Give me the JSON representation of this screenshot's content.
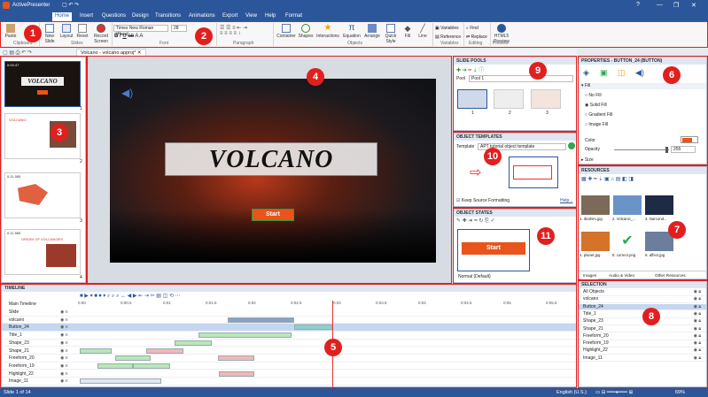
{
  "app": {
    "title": "ActivePresenter"
  },
  "menu": {
    "tabs": [
      "Home",
      "Insert",
      "Questions",
      "Design",
      "Transitions",
      "Animations",
      "Export",
      "View",
      "Help",
      "Format"
    ]
  },
  "ribbon": {
    "groups": [
      "Clipboard",
      "Slides",
      "Font",
      "Paragraph",
      "Objects",
      "Variables",
      "Editing",
      "Preview"
    ],
    "buttons": {
      "paste": "Paste",
      "new_slide": "New Slide",
      "layout": "Layout",
      "reset": "Reset",
      "record": "Record Screen",
      "container": "Container",
      "shapes": "Shapes",
      "interactions": "Interactions",
      "equation": "Equation",
      "arrange": "Arrange",
      "quick_style": "Quick Style",
      "fill": "Fill",
      "line": "Line",
      "variables": "Variables",
      "reference": "Reference",
      "find": "Find",
      "replace": "Replace",
      "html5_preview": "HTML5 Preview"
    },
    "font": {
      "family": "Times New Roman (Head",
      "size": "28"
    }
  },
  "document": {
    "tab": "Volcano - volcano.approj*"
  },
  "slides": {
    "thumbs": [
      {
        "time": "0:03.47",
        "title": "VOLCANO",
        "num": "1"
      },
      {
        "time": "",
        "title": "VOLCANO",
        "num": "2"
      },
      {
        "time": "0:11.565",
        "title": "",
        "num": "3"
      },
      {
        "time": "0:11.565",
        "title": "ORIGIN OF VOLCANOES",
        "num": "4"
      }
    ]
  },
  "canvas": {
    "title": "VOLCANO",
    "button": "Start"
  },
  "slide_pools": {
    "title": "SLIDE POOLS",
    "pool_label": "Pool",
    "pool_value": "Pool 1",
    "thumb_nums": [
      "1",
      "2",
      "3"
    ]
  },
  "object_templates": {
    "title": "OBJECT TEMPLATES",
    "template_label": "Template",
    "template_value": "APT tutorial object template",
    "keep_label": "Keep Source Formatting",
    "help": "Help..."
  },
  "object_states": {
    "title": "OBJECT STATES",
    "button": "Start",
    "state": "Normal (Default)"
  },
  "properties": {
    "title": "PROPERTIES - BUTTON_24 (BUTTON)",
    "fill_section": "Fill",
    "fill_options": [
      "No Fill",
      "Solid Fill",
      "Gradient Fill",
      "Image Fill"
    ],
    "selected_fill": "Solid Fill",
    "color_label": "Color",
    "opacity_label": "Opacity",
    "opacity_value": "255",
    "size_label": "Size",
    "accent": "#e8541c"
  },
  "resources": {
    "title": "RESOURCES",
    "items": [
      "1. ibrahim.jpg",
      "2. Volcanic_...",
      "3. Narcond...",
      "4. planet.jpg",
      "5. correct.png",
      "6. affect.jpg"
    ],
    "tabs": [
      "Images",
      "Audio & Video",
      "Other Resources"
    ]
  },
  "selection": {
    "title": "SELECTION",
    "items": [
      "All Objects",
      "volcano",
      "Button_24",
      "Title_1",
      "Shape_23",
      "Shape_21",
      "Freeform_20",
      "Freeform_19",
      "Highlight_22",
      "Image_11"
    ],
    "selected": "Button_24"
  },
  "timeline": {
    "title": "TIMELINE",
    "main": "Main Timeline",
    "ticks": [
      "0:00",
      "0:00.5",
      "0:01",
      "0:01.5",
      "0:02",
      "0:02.5",
      "0:03",
      "0:03.5",
      "0:04",
      "0:04.5",
      "0:05",
      "0:05.5"
    ],
    "rows": [
      "Slide",
      "volcano",
      "Button_24",
      "Title_1",
      "Shape_23",
      "Shape_21",
      "Freeform_20",
      "Freeform_19",
      "Highlight_22",
      "Image_11"
    ]
  },
  "status": {
    "slide": "Slide 1 of 14",
    "lang": "English (U.S.)",
    "zoom": "69%"
  },
  "badges": [
    "1",
    "2",
    "3",
    "4",
    "5",
    "6",
    "7",
    "8",
    "9",
    "10",
    "11"
  ]
}
